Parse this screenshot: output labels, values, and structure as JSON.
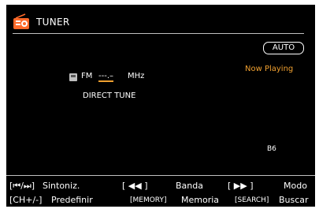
{
  "header": {
    "title": "TUNER",
    "icon": "radio-icon",
    "icon_color": "#ff6a2a"
  },
  "status": {
    "auto": "AUTO",
    "now_playing": "Now Playing"
  },
  "tuner": {
    "band": "FM",
    "frequency": "---.–",
    "unit": "MHz",
    "direct_tune": "DIRECT TUNE",
    "preset": "B6"
  },
  "footer": {
    "row1": [
      {
        "key": "[⏮/⏭]",
        "label": "Sintoniz."
      },
      {
        "key": "[ ◀◀ ]",
        "label": "Banda"
      },
      {
        "key": "[ ▶▶ ]",
        "label": "Modo"
      }
    ],
    "row2": [
      {
        "key": "[CH+/-]",
        "label": "Predefinir"
      },
      {
        "key": "[MEMORY]",
        "label": "Memoria"
      },
      {
        "key": "[SEARCH]",
        "label": "Buscar"
      }
    ]
  },
  "colors": {
    "accent": "#f0a030",
    "background": "#000000",
    "text": "#ffffff"
  }
}
